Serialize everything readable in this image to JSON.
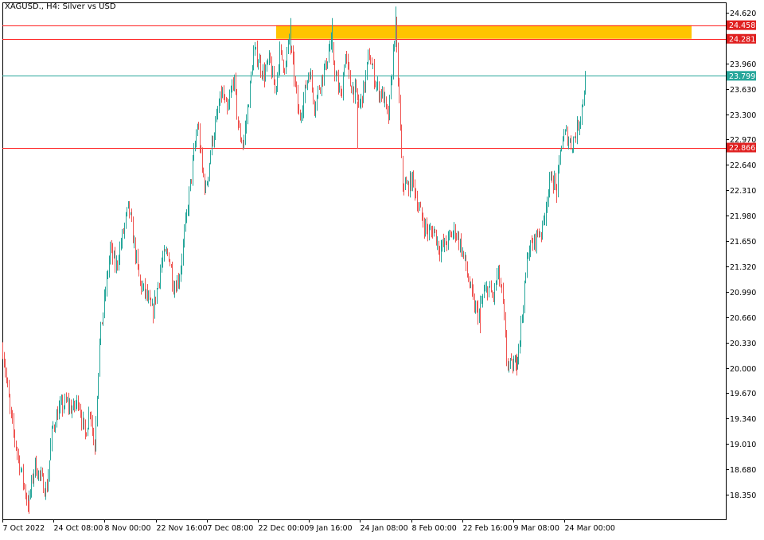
{
  "title": "XAGUSD., H4:  Silver vs USD",
  "chart_data": {
    "type": "candlestick",
    "timeframe": "H4",
    "symbol": "XAGUSD.",
    "ylim": [
      18.1,
      24.75
    ],
    "y_ticks": [
      "24.620",
      "24.290",
      "23.960",
      "23.630",
      "23.300",
      "22.970",
      "22.640",
      "22.310",
      "21.980",
      "21.650",
      "21.320",
      "20.990",
      "20.660",
      "20.330",
      "20.000",
      "19.670",
      "19.340",
      "19.010",
      "18.680",
      "18.350"
    ],
    "x_ticks": [
      "7 Oct 2022",
      "24 Oct 08:00",
      "8 Nov 00:00",
      "22 Nov 16:00",
      "7 Dec 08:00",
      "22 Dec 00:00",
      "9 Jan 16:00",
      "24 Jan 08:00",
      "8 Feb 00:00",
      "22 Feb 16:00",
      "9 Mar 08:00",
      "24 Mar 00:00"
    ],
    "bull_color": "#26a69a",
    "bear_color": "#ef5350",
    "path": [
      [
        0,
        20.25
      ],
      [
        10,
        19.35
      ],
      [
        18,
        18.9
      ],
      [
        25,
        18.55
      ],
      [
        32,
        18.2
      ],
      [
        40,
        18.75
      ],
      [
        48,
        18.55
      ],
      [
        55,
        18.4
      ],
      [
        62,
        19.2
      ],
      [
        70,
        19.45
      ],
      [
        80,
        19.55
      ],
      [
        88,
        19.45
      ],
      [
        95,
        19.6
      ],
      [
        103,
        19.1
      ],
      [
        110,
        19.5
      ],
      [
        115,
        18.9
      ],
      [
        118,
        19.6
      ],
      [
        122,
        20.4
      ],
      [
        128,
        20.9
      ],
      [
        135,
        21.55
      ],
      [
        142,
        21.3
      ],
      [
        150,
        21.7
      ],
      [
        158,
        22.1
      ],
      [
        165,
        21.6
      ],
      [
        172,
        21.1
      ],
      [
        180,
        20.95
      ],
      [
        188,
        20.7
      ],
      [
        195,
        21.1
      ],
      [
        200,
        21.4
      ],
      [
        208,
        21.5
      ],
      [
        215,
        21.05
      ],
      [
        222,
        21.2
      ],
      [
        230,
        21.9
      ],
      [
        238,
        22.6
      ],
      [
        245,
        23.2
      ],
      [
        250,
        22.6
      ],
      [
        255,
        22.3
      ],
      [
        262,
        22.9
      ],
      [
        268,
        23.2
      ],
      [
        275,
        23.6
      ],
      [
        282,
        23.3
      ],
      [
        290,
        23.8
      ],
      [
        296,
        23.1
      ],
      [
        302,
        22.9
      ],
      [
        308,
        23.4
      ],
      [
        315,
        24.1
      ],
      [
        320,
        24.05
      ],
      [
        328,
        23.8
      ],
      [
        335,
        24.0
      ],
      [
        342,
        23.6
      ],
      [
        348,
        24.1
      ],
      [
        355,
        23.9
      ],
      [
        360,
        24.3
      ],
      [
        366,
        23.8
      ],
      [
        372,
        23.25
      ],
      [
        378,
        23.5
      ],
      [
        385,
        23.9
      ],
      [
        392,
        23.4
      ],
      [
        398,
        23.7
      ],
      [
        405,
        23.9
      ],
      [
        412,
        24.25
      ],
      [
        418,
        23.8
      ],
      [
        425,
        23.5
      ],
      [
        430,
        24.1
      ],
      [
        436,
        23.7
      ],
      [
        442,
        23.6
      ],
      [
        448,
        23.4
      ],
      [
        455,
        23.7
      ],
      [
        460,
        24.1
      ],
      [
        466,
        23.8
      ],
      [
        472,
        23.6
      ],
      [
        478,
        23.55
      ],
      [
        484,
        23.2
      ],
      [
        488,
        23.7
      ],
      [
        493,
        24.5
      ],
      [
        498,
        23.45
      ],
      [
        502,
        22.4
      ],
      [
        508,
        22.35
      ],
      [
        515,
        22.45
      ],
      [
        522,
        22.1
      ],
      [
        528,
        21.9
      ],
      [
        535,
        21.75
      ],
      [
        542,
        21.8
      ],
      [
        548,
        21.55
      ],
      [
        555,
        21.6
      ],
      [
        562,
        21.7
      ],
      [
        568,
        21.8
      ],
      [
        575,
        21.6
      ],
      [
        580,
        21.4
      ],
      [
        586,
        21.1
      ],
      [
        592,
        20.8
      ],
      [
        598,
        20.7
      ],
      [
        604,
        20.95
      ],
      [
        610,
        21.05
      ],
      [
        616,
        20.9
      ],
      [
        622,
        21.25
      ],
      [
        628,
        20.9
      ],
      [
        633,
        20.1
      ],
      [
        638,
        20.0
      ],
      [
        644,
        20.05
      ],
      [
        650,
        20.45
      ],
      [
        655,
        20.95
      ],
      [
        660,
        21.55
      ],
      [
        666,
        21.6
      ],
      [
        672,
        21.75
      ],
      [
        678,
        21.8
      ],
      [
        684,
        22.25
      ],
      [
        690,
        22.5
      ],
      [
        696,
        22.3
      ],
      [
        702,
        22.95
      ],
      [
        708,
        23.05
      ],
      [
        714,
        22.9
      ],
      [
        720,
        23.05
      ],
      [
        726,
        23.3
      ],
      [
        733,
        23.8
      ]
    ],
    "spikes": [
      {
        "x": 362,
        "y": 24.55
      },
      {
        "x": 414,
        "y": 24.55
      },
      {
        "x": 446,
        "y": 22.85
      },
      {
        "x": 494,
        "y": 24.7
      },
      {
        "x": 33,
        "y": 18.1
      },
      {
        "x": 600,
        "y": 20.45
      },
      {
        "x": 646,
        "y": 19.9
      }
    ],
    "levels": [
      {
        "value": 24.458,
        "label": "24.458",
        "color": "#ff2020",
        "bg": "#e02020"
      },
      {
        "value": 24.281,
        "label": "24.281",
        "color": "#ff2020",
        "bg": "#e02020"
      },
      {
        "value": 23.799,
        "label": "23.799",
        "color": "#26a69a",
        "bg": "#26a69a"
      },
      {
        "value": 22.866,
        "label": "22.866",
        "color": "#ff2020",
        "bg": "#e02020"
      }
    ],
    "zone": {
      "from": 24.281,
      "to": 24.458,
      "color": "#ffc400"
    }
  }
}
